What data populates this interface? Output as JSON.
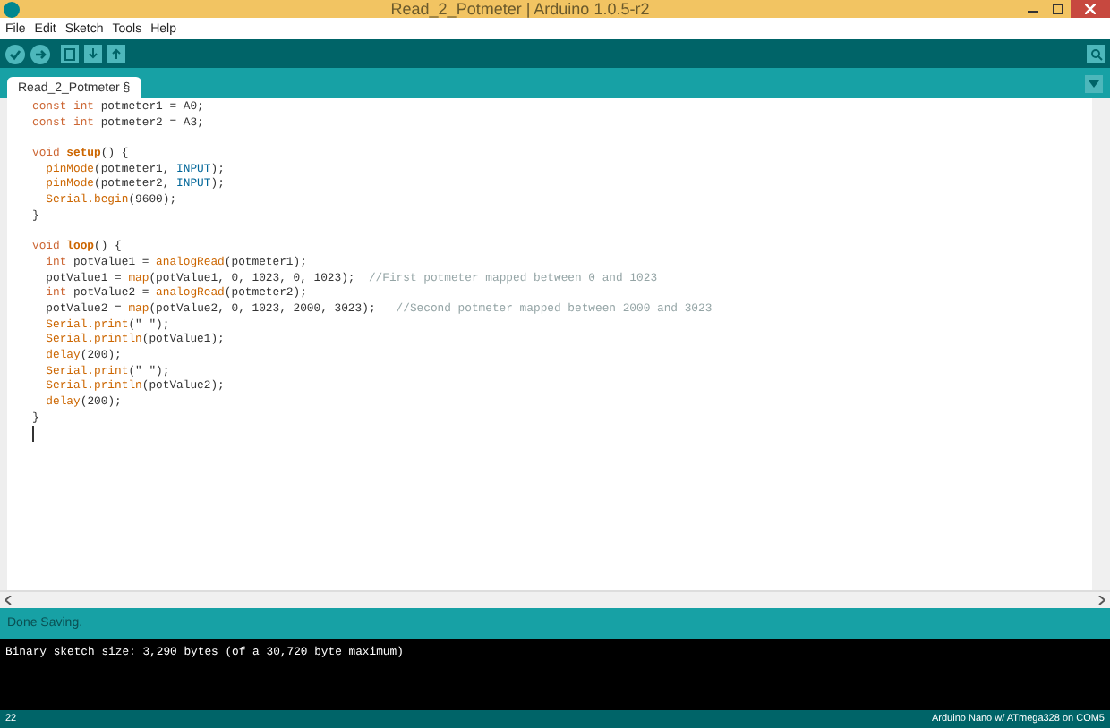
{
  "window": {
    "title": "Read_2_Potmeter | Arduino 1.0.5-r2"
  },
  "menu": [
    "File",
    "Edit",
    "Sketch",
    "Tools",
    "Help"
  ],
  "tabs": [
    {
      "label": "Read_2_Potmeter §",
      "selected": true
    }
  ],
  "code": [
    {
      "tokens": [
        {
          "text": "const int",
          "kind": "keyword"
        },
        {
          "text": " potmeter1 = A0;",
          "kind": "plain"
        }
      ]
    },
    {
      "tokens": [
        {
          "text": "const int",
          "kind": "keyword"
        },
        {
          "text": " potmeter2 = A3;",
          "kind": "plain"
        }
      ]
    },
    {
      "gap_before": true,
      "tokens": [
        {
          "text": "void",
          "kind": "keyword"
        },
        {
          "text": " setup",
          "kind": "bold"
        },
        {
          "text": "() {",
          "kind": "plain"
        }
      ]
    },
    {
      "tokens": [
        {
          "text": "  pinMode",
          "kind": "func"
        },
        {
          "text": "(potmeter1, ",
          "kind": "plain"
        },
        {
          "text": "INPUT",
          "kind": "const"
        },
        {
          "text": ");",
          "kind": "plain"
        }
      ]
    },
    {
      "tokens": [
        {
          "text": "  pinMode",
          "kind": "func"
        },
        {
          "text": "(potmeter2, ",
          "kind": "plain"
        },
        {
          "text": "INPUT",
          "kind": "const"
        },
        {
          "text": ");",
          "kind": "plain"
        }
      ]
    },
    {
      "tokens": [
        {
          "text": "  Serial.begin",
          "kind": "func"
        },
        {
          "text": "(9600);",
          "kind": "plain"
        }
      ]
    },
    {
      "tokens": [
        {
          "text": "}",
          "kind": "plain"
        }
      ]
    },
    {
      "gap_before": true,
      "tokens": [
        {
          "text": "void",
          "kind": "keyword"
        },
        {
          "text": " loop",
          "kind": "bold"
        },
        {
          "text": "() {",
          "kind": "plain"
        }
      ]
    },
    {
      "tokens": [
        {
          "text": "  int",
          "kind": "keyword"
        },
        {
          "text": " potValue1 = ",
          "kind": "plain"
        },
        {
          "text": "analogRead",
          "kind": "func"
        },
        {
          "text": "(potmeter1);",
          "kind": "plain"
        }
      ]
    },
    {
      "tokens": [
        {
          "text": "  potValue1 = ",
          "kind": "plain"
        },
        {
          "text": "map",
          "kind": "func"
        },
        {
          "text": "(potValue1, 0, 1023, 0, 1023);  ",
          "kind": "plain"
        },
        {
          "text": "//First potmeter mapped between 0 and 1023",
          "kind": "comment"
        }
      ]
    },
    {
      "tokens": [
        {
          "text": "  int",
          "kind": "keyword"
        },
        {
          "text": " potValue2 = ",
          "kind": "plain"
        },
        {
          "text": "analogRead",
          "kind": "func"
        },
        {
          "text": "(potmeter2);",
          "kind": "plain"
        }
      ]
    },
    {
      "tokens": [
        {
          "text": "  potValue2 = ",
          "kind": "plain"
        },
        {
          "text": "map",
          "kind": "func"
        },
        {
          "text": "(potValue2, 0, 1023, 2000, 3023);   ",
          "kind": "plain"
        },
        {
          "text": "//Second potmeter mapped between 2000 and 3023",
          "kind": "comment"
        }
      ]
    },
    {
      "tokens": [
        {
          "text": "  Serial.print",
          "kind": "func"
        },
        {
          "text": "(\" \");",
          "kind": "plain"
        }
      ]
    },
    {
      "tokens": [
        {
          "text": "  Serial.println",
          "kind": "func"
        },
        {
          "text": "(potValue1);",
          "kind": "plain"
        }
      ]
    },
    {
      "tokens": [
        {
          "text": "  delay",
          "kind": "func"
        },
        {
          "text": "(200);",
          "kind": "plain"
        }
      ]
    },
    {
      "tokens": [
        {
          "text": "  Serial.print",
          "kind": "func"
        },
        {
          "text": "(\" \");",
          "kind": "plain"
        }
      ]
    },
    {
      "tokens": [
        {
          "text": "  Serial.println",
          "kind": "func"
        },
        {
          "text": "(potValue2);",
          "kind": "plain"
        }
      ]
    },
    {
      "tokens": [
        {
          "text": "  delay",
          "kind": "func"
        },
        {
          "text": "(200);",
          "kind": "plain"
        }
      ]
    },
    {
      "tokens": [
        {
          "text": "}",
          "kind": "plain"
        }
      ]
    }
  ],
  "status": {
    "message": "Done Saving."
  },
  "console": [
    "Binary sketch size: 3,290 bytes (of a 30,720 byte maximum)"
  ],
  "status_bar": {
    "line": "22",
    "board": "Arduino Nano w/ ATmega328 on COM5"
  }
}
